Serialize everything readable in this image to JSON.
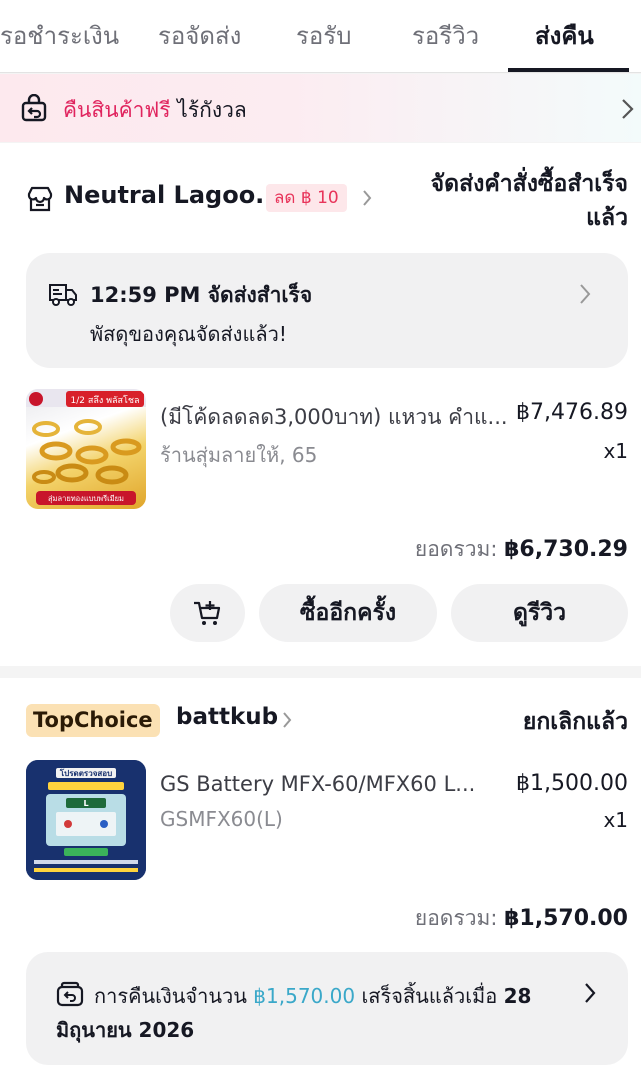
{
  "tabs": [
    {
      "label": "รอชำระเงิน"
    },
    {
      "label": "รอจัดส่ง"
    },
    {
      "label": "รอรับ"
    },
    {
      "label": "รอรีวิว"
    },
    {
      "label": "ส่งคืน",
      "active": true
    }
  ],
  "banner": {
    "accent_text": "คืนสินค้าฟรี",
    "rest_text": "ไร้กังวล",
    "icon": "return-bag-icon"
  },
  "order1": {
    "shop_name": "Neutral Lagoo...",
    "discount_badge": "ลด ฿ 10",
    "status_line1": "จัดส่งคำสั่งซื้อสำเร็จ",
    "status_line2": "แล้ว",
    "delivery": {
      "time_status": "12:59 PM จัดส่งสำเร็จ",
      "message": "พัสดุของคุณจัดส่งแล้ว!",
      "icon": "truck-icon"
    },
    "product": {
      "title": "(มีโค้ดลดลด3,000บาท) แหวน คำแ...",
      "variant": "ร้านสุ่มลายให้, 65",
      "price": "฿7,476.89",
      "qty": "x1",
      "thumb_badge": "1/2 สลึง พลัสโชล",
      "thumb_caption": "สุ่มลายทองแบบพรีเมียม"
    },
    "total_label": "ยอดรวม: ",
    "total_value": "฿6,730.29",
    "buttons": {
      "rebuy": "ซื้ออีกครั้ง",
      "review": "ดูรีวิว"
    }
  },
  "order2": {
    "badge": "TopChoice",
    "shop_name": "battkub",
    "status": "ยกเลิกแล้ว",
    "product": {
      "title": "GS Battery MFX-60/MFX60 L...",
      "variant": "GSMFX60(L)",
      "price": "฿1,500.00",
      "qty": "x1",
      "thumb_heading": "โปรดตรวจสอบ",
      "thumb_label": "L"
    },
    "total_label": "ยอดรวม: ",
    "total_value": "฿1,570.00",
    "refund": {
      "prefix": "การคืนเงินจำนวน ",
      "amount": "฿1,570.00",
      "middle": " เสร็จสิ้นแล้วเมื่อ ",
      "date_part1": "28",
      "date_part2": "มิถุนายน 2026"
    }
  },
  "colors": {
    "accent_pink": "#e0245e",
    "refund_blue": "#3aa8c9",
    "topchoice_bg": "#fbe1b4"
  }
}
